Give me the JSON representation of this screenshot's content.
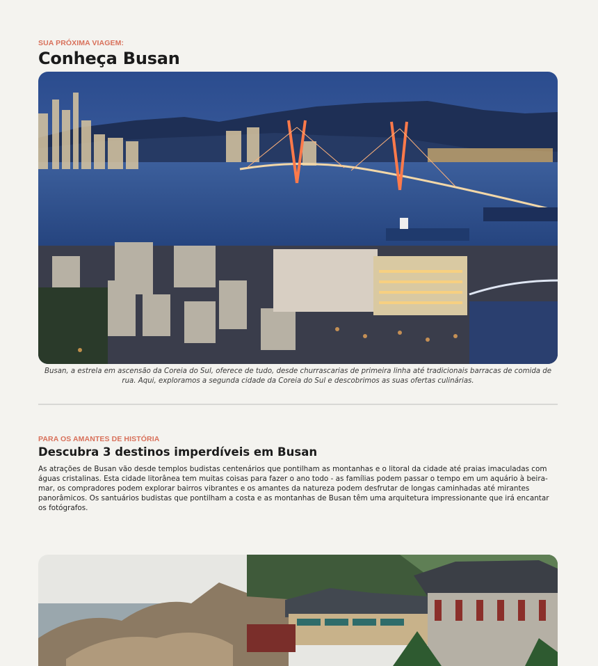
{
  "section1": {
    "kicker": "SUA PRÓXIMA VIAGEM:",
    "title": "Conheça Busan",
    "caption": "Busan, a estrela em ascensão da Coreia do Sul, oferece de tudo, desde churrascarias de primeira linha até tradicionais barracas de comida de rua. Aqui, exploramos a segunda cidade da Coreia do Sul e descobrimos as suas ofertas culinárias."
  },
  "section2": {
    "kicker": "PARA OS AMANTES DE HISTÓRIA",
    "title": "Descubra 3 destinos imperdíveis em Busan",
    "body": "As atrações de Busan vão desde templos budistas centenários que pontilham as montanhas e o litoral da cidade até praias imaculadas com águas cristalinas. Esta cidade litorânea tem muitas coisas para fazer o ano todo - as famílias podem passar o tempo em um aquário à beira-mar, os compradores podem explorar bairros vibrantes e os amantes da natureza podem desfrutar de longas caminhadas até mirantes panorâmicos. Os santuários budistas que pontilham a costa e as montanhas de Busan têm uma arquitetura impressionante que irá encantar os fotógrafos."
  }
}
